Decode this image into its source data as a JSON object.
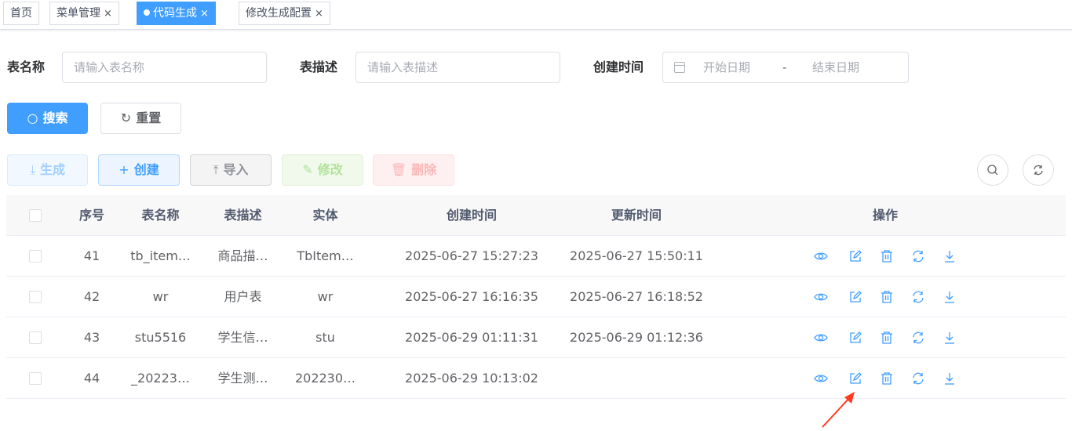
{
  "tags": [
    {
      "label": "首页",
      "closable": false,
      "active": false
    },
    {
      "label": "菜单管理",
      "closable": true,
      "active": false
    },
    {
      "label": "代码生成",
      "closable": true,
      "active": true
    },
    {
      "label": "修改生成配置",
      "closable": true,
      "active": false
    }
  ],
  "close_glyph": "×",
  "search": {
    "table_name_label": "表名称",
    "table_name_placeholder": "请输入表名称",
    "table_desc_label": "表描述",
    "table_desc_placeholder": "请输入表描述",
    "created_label": "创建时间",
    "start_placeholder": "开始日期",
    "range_separator": "-",
    "end_placeholder": "结束日期",
    "search_button": "搜索",
    "reset_button": "重置"
  },
  "toolbar": {
    "generate": "生成",
    "create": "创建",
    "import": "导入",
    "edit": "修改",
    "delete": "删除"
  },
  "table": {
    "columns": [
      "序号",
      "表名称",
      "表描述",
      "实体",
      "创建时间",
      "更新时间",
      "操作"
    ],
    "rows": [
      {
        "index": "41",
        "table_name": "tb_item…",
        "table_desc": "商品描…",
        "entity": "TbItem…",
        "created": "2025-06-27 15:27:23",
        "updated": "2025-06-27 15:50:11"
      },
      {
        "index": "42",
        "table_name": "wr",
        "table_desc": "用户表",
        "entity": "wr",
        "created": "2025-06-27 16:16:35",
        "updated": "2025-06-27 16:18:52"
      },
      {
        "index": "43",
        "table_name": "stu5516",
        "table_desc": "学生信…",
        "entity": "stu",
        "created": "2025-06-29 01:11:31",
        "updated": "2025-06-29 01:12:36"
      },
      {
        "index": "44",
        "table_name": "_20223…",
        "table_desc": "学生测…",
        "entity": "202230…",
        "created": "2025-06-29 10:13:02",
        "updated": ""
      }
    ]
  },
  "colors": {
    "primary": "#409eff",
    "annotation_arrow": "#ff3b1f"
  }
}
